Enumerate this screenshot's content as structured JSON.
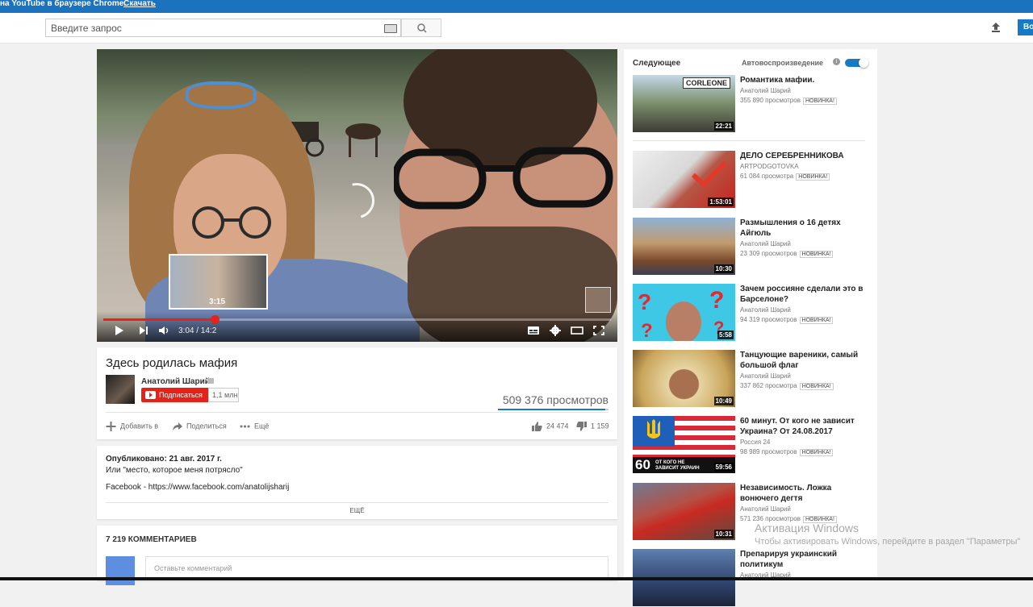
{
  "banner": {
    "message": "на YouTube в браузере Chrome.",
    "download": "Скачать"
  },
  "header": {
    "search_placeholder": "Введите запрос",
    "signin": "Во"
  },
  "player": {
    "time_current": "3:04",
    "time_total": "14:2",
    "time_display": "3:04 / 14:2",
    "preview_time": "3:15",
    "progress_fraction": 0.22
  },
  "video": {
    "title": "Здесь родилась мафия",
    "channel": "Анатолий Шарий",
    "subscribe": "Подписаться",
    "subscribers": "1,1 млн",
    "views": "509 376 просмотров",
    "add_to": "Добавить в",
    "share": "Поделиться",
    "more": "Ещё",
    "likes": "24 474",
    "dislikes": "1 159"
  },
  "description": {
    "published": "Опубликовано: 21 авг. 2017 г.",
    "line1": "Или \"место, которое меня потрясло\"",
    "line2": "Facebook - https://www.facebook.com/anatolijsharij",
    "more": "ЕЩЁ"
  },
  "comments": {
    "count_label": "7 219 КОММЕНТАРИЕВ",
    "placeholder": "Оставьте комментарий"
  },
  "sidebar": {
    "next_label": "Следующее",
    "autoplay_label": "Автовоспроизведение",
    "autoplay_on": true,
    "items": [
      {
        "title": "Романтика мафии.",
        "channel": "Анатолий Шарий",
        "views": "355 890 просмотров",
        "badge": "НОВИНКА!",
        "duration": "22:21"
      },
      {
        "title": "ДЕЛО СЕРЕБРЕННИКОВА",
        "channel": "ARTPODGOTOVKA",
        "views": "61 084 просмотра",
        "badge": "НОВИНКА!",
        "duration": "1:53:01"
      },
      {
        "title": "Размышления о 16 детях Айгюль",
        "channel": "Анатолий Шарий",
        "views": "23 309 просмотров",
        "badge": "НОВИНКА!",
        "duration": "10:30"
      },
      {
        "title": "Зачем россияне сделали это в Барселоне?",
        "channel": "Анатолий Шарий",
        "views": "94 319 просмотров",
        "badge": "НОВИНКА!",
        "duration": "5:58"
      },
      {
        "title": "Танцующие вареники, самый большой флаг",
        "channel": "Анатолий Шарий",
        "views": "337 862 просмотра",
        "badge": "НОВИНКА!",
        "duration": "10:49"
      },
      {
        "title": "60 минут. От кого не зависит Украина? От 24.08.2017",
        "channel": "Россия 24",
        "views": "98 989 просмотров",
        "badge": "НОВИНКА!",
        "duration": "59:56"
      },
      {
        "title": "Независимость. Ложка вонючего дегтя",
        "channel": "Анатолий Шарий",
        "views": "571 236 просмотров",
        "badge": "НОВИНКА!",
        "duration": "10:31"
      },
      {
        "title": "Препарируя украинский политикум",
        "channel": "Анатолий Шарий",
        "views": "",
        "badge": "",
        "duration": ""
      }
    ]
  },
  "thumb_text": {
    "corleone": "CORLEONE",
    "sixty": "60",
    "sixty_caption": "ОТ КОГО НЕ ЗАВИСИТ УКРАИН"
  },
  "windows_watermark": {
    "line1": "Активация Windows",
    "line2": "Чтобы активировать Windows, перейдите в раздел \"Параметры\""
  },
  "colors": {
    "accent_blue": "#167ac6",
    "youtube_red": "#e62117",
    "banner_blue": "#1b72be"
  }
}
